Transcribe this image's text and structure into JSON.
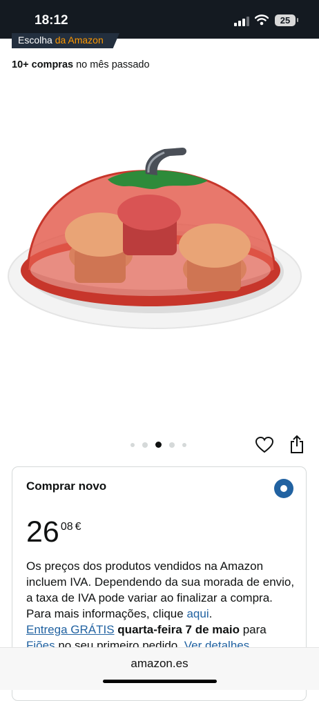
{
  "status_bar": {
    "time": "18:12",
    "battery": "25"
  },
  "badge": {
    "prefix": "Escolha",
    "brand": "da Amazon"
  },
  "purchases": {
    "count": "10+ compras",
    "period": "no mês passado"
  },
  "gallery": {
    "image_count": 5,
    "active_index": 2
  },
  "offer": {
    "title": "Comprar novo",
    "price_whole": "26",
    "price_fraction": "08",
    "currency": "€",
    "vat_text": "Os preços dos produtos vendidos na Amazon incluem IVA. Dependendo da sua morada de envio, a taxa de IVA pode variar ao finalizar a compra. Para mais informações, clique",
    "vat_link": "aqui",
    "vat_end": ".",
    "delivery_link": "Entrega GRÁTIS",
    "delivery_date": "quarta-feira 7 de maio",
    "delivery_to": "para",
    "delivery_line2_link": "Fiões",
    "delivery_line2_text": "no seu primeiro pedido.",
    "details_link": "Ver detalhes"
  },
  "browser": {
    "domain": "amazon.es"
  },
  "colors": {
    "link": "#2162a1",
    "badge_bg": "#232f3e",
    "badge_accent": "#ff9900",
    "status_bg": "#141a21"
  }
}
